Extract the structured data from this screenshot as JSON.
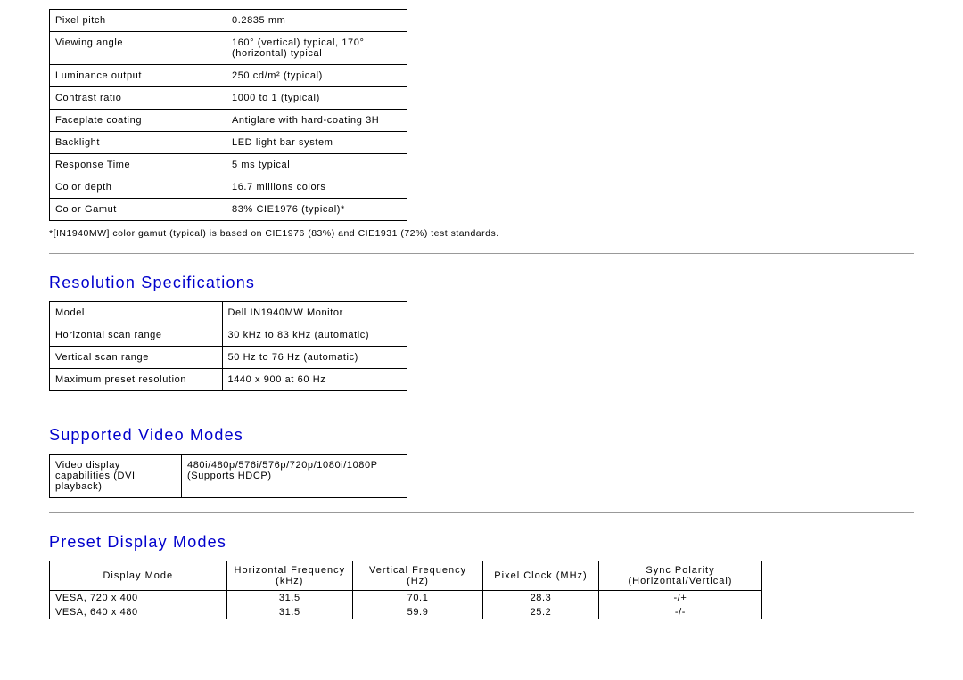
{
  "flat_panel": {
    "rows": [
      [
        "Pixel pitch",
        "0.2835 mm"
      ],
      [
        "Viewing angle",
        "160° (vertical) typical, 170° (horizontal) typical"
      ],
      [
        "Luminance output",
        "250 cd/m² (typical)"
      ],
      [
        "Contrast ratio",
        "1000 to 1 (typical)"
      ],
      [
        "Faceplate coating",
        "Antiglare with hard-coating 3H"
      ],
      [
        "Backlight",
        "LED light bar system"
      ],
      [
        "Response Time",
        "5 ms typical"
      ],
      [
        "Color depth",
        "16.7 millions colors"
      ],
      [
        "Color Gamut",
        "83% CIE1976 (typical)*"
      ]
    ]
  },
  "footnote": "*[IN1940MW] color gamut (typical) is based on CIE1976 (83%) and CIE1931 (72%) test standards.",
  "headings": {
    "resolution": "Resolution Specifications",
    "video_modes": "Supported Video Modes",
    "preset": "Preset Display Modes"
  },
  "resolution": {
    "rows": [
      [
        "Model",
        "Dell IN1940MW Monitor"
      ],
      [
        "Horizontal scan range",
        "30 kHz to 83 kHz (automatic)"
      ],
      [
        "Vertical scan range",
        "50 Hz to 76 Hz (automatic)"
      ],
      [
        "Maximum preset resolution",
        "1440 x 900 at 60 Hz"
      ]
    ]
  },
  "video_modes": {
    "label": "Video display capabilities (DVI playback)",
    "value": "480i/480p/576i/576p/720p/1080i/1080P (Supports HDCP)"
  },
  "preset_headers": [
    "Display Mode",
    "Horizontal Frequency (kHz)",
    "Vertical Frequency (Hz)",
    "Pixel Clock (MHz)",
    "Sync Polarity (Horizontal/Vertical)"
  ],
  "preset_rows": [
    [
      "VESA, 720 x 400",
      "31.5",
      "70.1",
      "28.3",
      "-/+"
    ],
    [
      "VESA, 640 x 480",
      "31.5",
      "59.9",
      "25.2",
      "-/-"
    ]
  ],
  "chart_data": {
    "type": "table",
    "title": "Preset Display Modes",
    "columns": [
      "Display Mode",
      "Horizontal Frequency (kHz)",
      "Vertical Frequency (Hz)",
      "Pixel Clock (MHz)",
      "Sync Polarity (Horizontal/Vertical)"
    ],
    "rows": [
      [
        "VESA, 720 x 400",
        31.5,
        70.1,
        28.3,
        "-/+"
      ],
      [
        "VESA, 640 x 480",
        31.5,
        59.9,
        25.2,
        "-/-"
      ]
    ]
  }
}
